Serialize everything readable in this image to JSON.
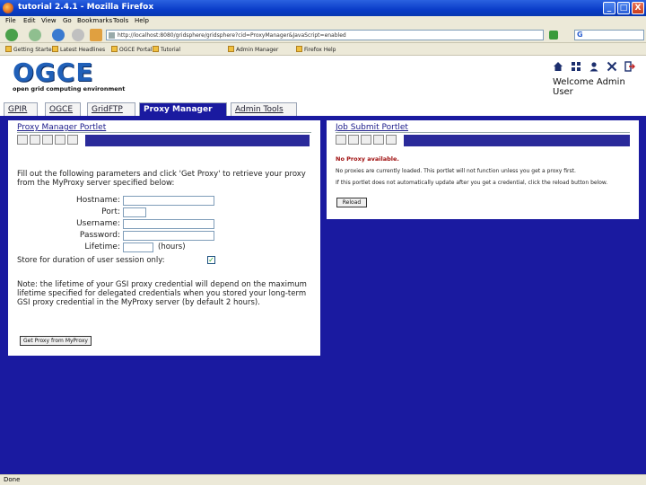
{
  "window": {
    "title": "tutorial 2.4.1 - Mozilla Firefox",
    "minimize": "_",
    "maximize": "□",
    "close": "X"
  },
  "menu": [
    "File",
    "Edit",
    "View",
    "Go",
    "Bookmarks",
    "Tools",
    "Help"
  ],
  "nav": {
    "url": "http://localhost:8080/gridsphere/gridsphere?cid=ProxyManager&JavaScript=enabled",
    "search_glyph": "G"
  },
  "bookmarks": [
    "Getting Started",
    "Latest Headlines",
    "OGCE Portal",
    "Tutorial",
    "Admin Manager",
    "Firefox Help"
  ],
  "logo": {
    "text": "OGCE",
    "subtitle": "open grid computing environment"
  },
  "header_icons": [
    "home-icon",
    "grid-icon",
    "profile-icon",
    "tools-icon",
    "logout-icon"
  ],
  "welcome": {
    "line1": "Welcome Admin",
    "line2": "User"
  },
  "tabs": [
    {
      "label": "GPIR",
      "active": false
    },
    {
      "label": "OGCE",
      "active": false
    },
    {
      "label": "GridFTP",
      "active": false
    },
    {
      "label": "Proxy Manager",
      "active": true
    },
    {
      "label": "Admin Tools",
      "active": false
    }
  ],
  "proxy_portlet": {
    "title": "Proxy Manager Portlet",
    "tool_icons": [
      "edit-icon",
      "zoom-icon",
      "maximize-icon",
      "minimize-icon",
      "help-icon"
    ],
    "intro": "Fill out the following parameters and click 'Get Proxy' to retrieve your proxy from the MyProxy server specified below:",
    "fields": {
      "hostname": {
        "label": "Hostname:",
        "value": ""
      },
      "port": {
        "label": "Port:",
        "value": ""
      },
      "username": {
        "label": "Username:",
        "value": ""
      },
      "password": {
        "label": "Password:",
        "value": ""
      },
      "lifetime": {
        "label": "Lifetime:",
        "value": "",
        "unit": "(hours)"
      }
    },
    "store_label": "Store for duration of user session only:",
    "store_checked": true,
    "note": "Note: the lifetime of your GSI proxy credential will depend on the maximum lifetime specified for delegated credentials when you stored your long-term GSI proxy credential in the MyProxy server (by default 2 hours).",
    "button": "Get Proxy from MyProxy"
  },
  "job_portlet": {
    "title": "Job Submit Portlet",
    "tool_icons": [
      "edit-icon",
      "zoom-icon",
      "maximize-icon",
      "minimize-icon",
      "help-icon"
    ],
    "line1": "No Proxy available.",
    "line2": "No proxies are currently loaded. This portlet will not function unless you get a proxy first.",
    "line3": "If this portlet does not automatically update after you get a credential, click the reload button below.",
    "button": "Reload"
  },
  "status": "Done"
}
